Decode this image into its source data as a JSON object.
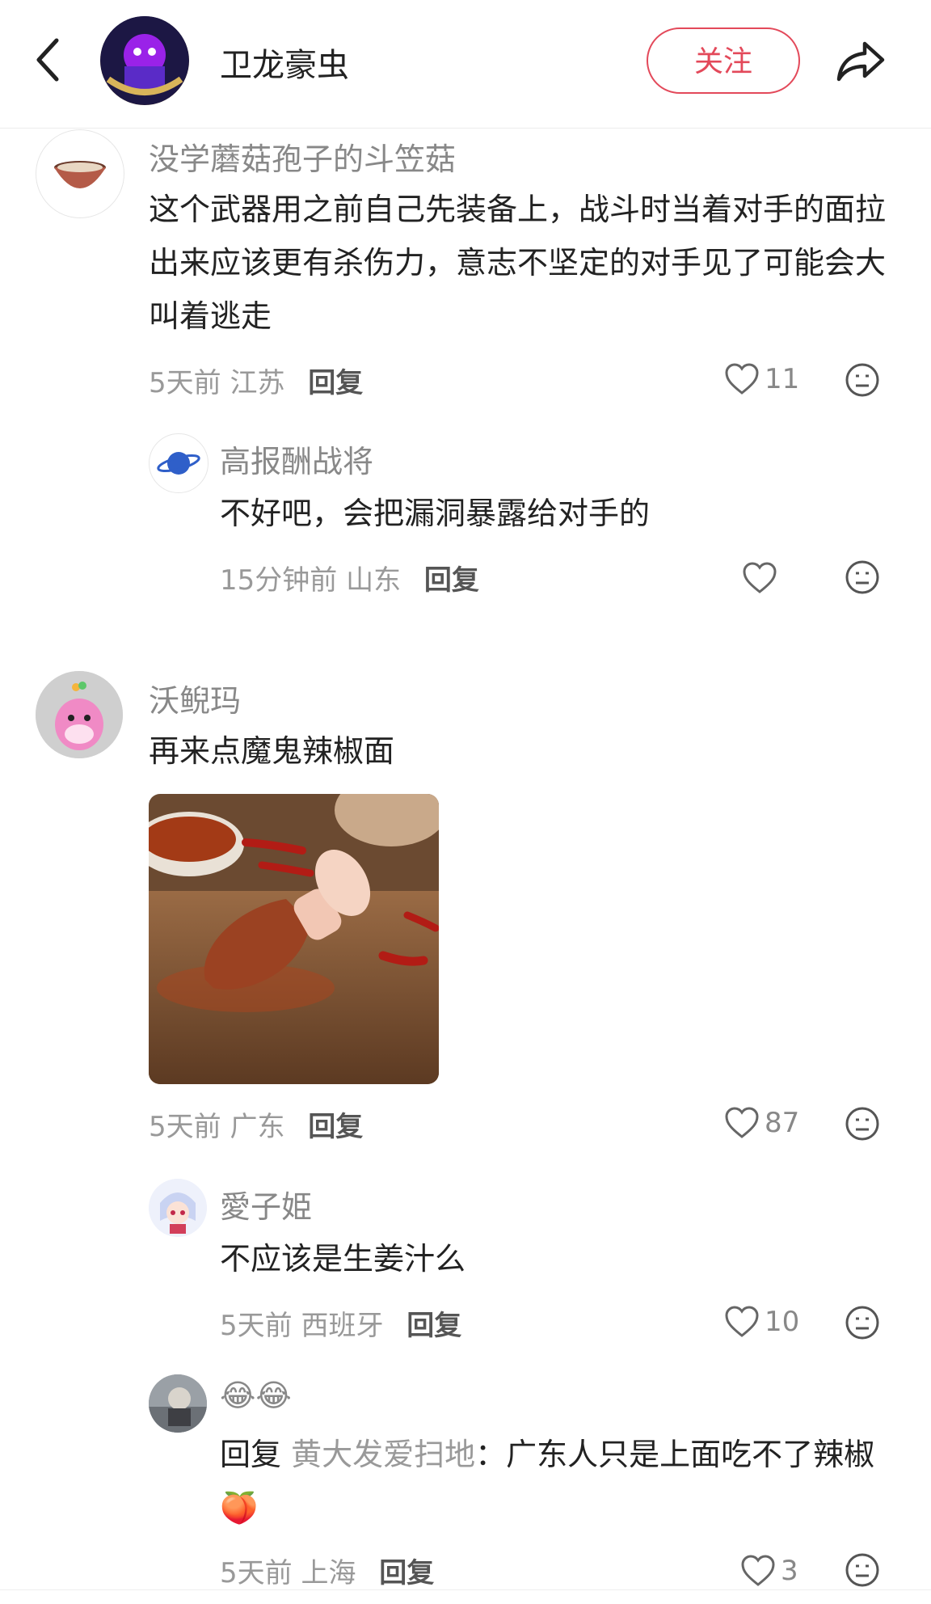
{
  "header": {
    "username": "卫龙豪虫",
    "follow_label": "关注"
  },
  "comments": [
    {
      "username": "没学蘑菇孢子的斗笠菇",
      "text": "这个武器用之前自己先装备上，战斗时当着对手的面拉出来应该更有杀伤力，意志不坚定的对手见了可能会大叫着逃走",
      "time": "5天前",
      "location": "江苏",
      "reply_label": "回复",
      "likes": "11",
      "replies": [
        {
          "username": "高报酬战将",
          "text": "不好吧，会把漏洞暴露给对手的",
          "time": "15分钟前",
          "location": "山东",
          "reply_label": "回复",
          "likes": ""
        }
      ]
    },
    {
      "username": "沃鲵玛",
      "text": "再来点魔鬼辣椒面",
      "time": "5天前",
      "location": "广东",
      "reply_label": "回复",
      "likes": "87",
      "replies": [
        {
          "username": "愛子姫",
          "text": "不应该是生姜汁么",
          "time": "5天前",
          "location": "西班牙",
          "reply_label": "回复",
          "likes": "10"
        },
        {
          "username": "😂😂",
          "reply_prefix": "回复",
          "reply_to": "黄大发爱扫地",
          "reply_colon": "：",
          "text": "广东人只是上面吃不了辣椒🍑",
          "time": "5天前",
          "location": "上海",
          "reply_label": "回复",
          "likes": "3"
        }
      ]
    }
  ],
  "icons": {
    "back": "back-arrow-icon",
    "share": "share-icon",
    "like": "heart-outline-icon",
    "react": "neutral-face-icon"
  },
  "colors": {
    "follow_accent": "#e3495a",
    "muted_text": "#999999"
  }
}
